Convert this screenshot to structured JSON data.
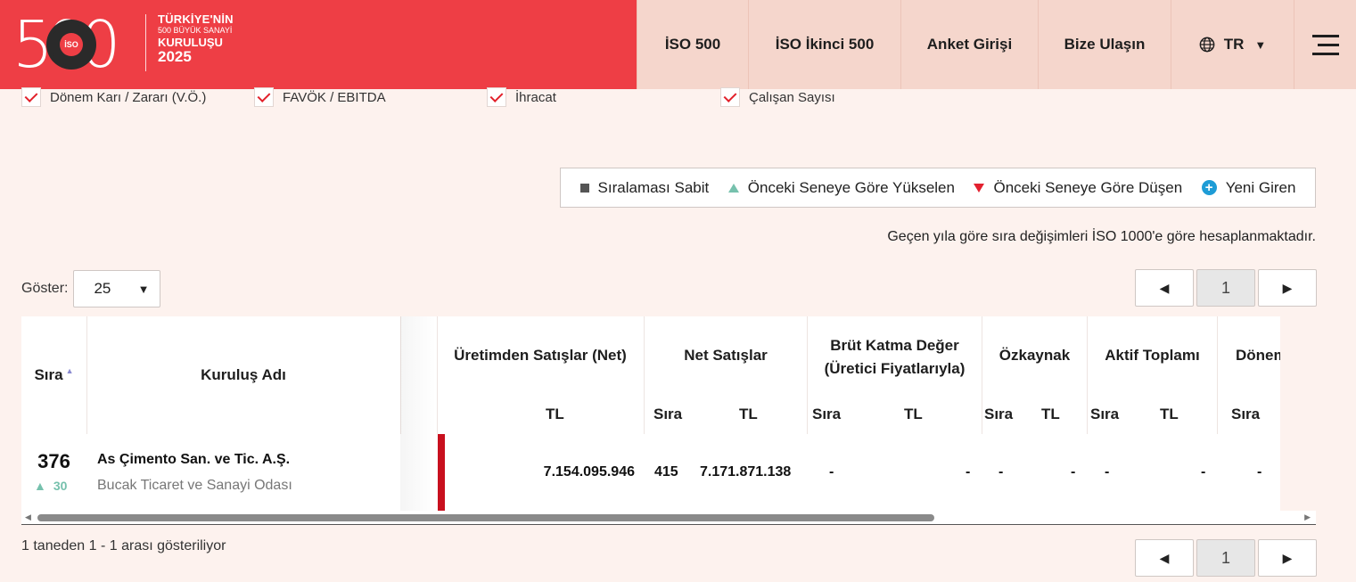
{
  "brand": {
    "logo_number": "500",
    "logo_badge": "İSO",
    "line1": "TÜRKİYE'NİN",
    "line2": "500 BÜYÜK SANAYİ",
    "line3": "KURULUŞU",
    "line4": "2025",
    "accent_color": "#ee3e45"
  },
  "nav": {
    "items": [
      "İSO 500",
      "İSO İkinci 500",
      "Anket Girişi",
      "Bize Ulaşın"
    ],
    "language": "TR",
    "language_icon": "globe-icon",
    "menu_icon": "hamburger-menu-icon"
  },
  "filters": {
    "checkboxes": [
      "Dönem Karı / Zararı (V.Ö.)",
      "FAVÖK / EBITDA",
      "İhracat",
      "Çalışan Sayısı"
    ]
  },
  "legend": {
    "items": [
      "Sıralaması Sabit",
      "Önceki Seneye Göre Yükselen",
      "Önceki Seneye Göre Düşen",
      "Yeni Giren"
    ],
    "colors": {
      "fixed": "#555555",
      "up": "#76c1ad",
      "down": "#e3212f",
      "new": "#1e9cd6"
    }
  },
  "note": "Geçen yıla göre sıra değişimleri İSO 1000'e göre hesaplanmaktadır.",
  "show": {
    "label": "Göster:",
    "value": "25"
  },
  "pagination": {
    "prev": "◀",
    "current": "1",
    "next": "▶"
  },
  "table": {
    "headers": {
      "rank": "Sıra",
      "name": "Kuruluş Adı",
      "production_sales": "Üretimden Satışlar (Net)",
      "net_sales": "Net Satışlar",
      "gross_value_added": "Brüt Katma Değer (Üretici Fiyatlarıyla)",
      "equity": "Özkaynak",
      "total_assets": "Aktif Toplamı",
      "period": "Dönem"
    },
    "subheaders": {
      "rank": "Sıra",
      "tl": "TL"
    },
    "rows": [
      {
        "rank": "376",
        "rank_change": "30",
        "company": "As Çimento San. ve Tic. A.Ş.",
        "chamber": "Bucak Ticaret ve Sanayi Odası",
        "production_sales_tl": "7.154.095.946",
        "net_sales_rank": "415",
        "net_sales_tl": "7.171.871.138",
        "gva_rank": "-",
        "gva_tl": "-",
        "equity_rank": "-",
        "equity_tl": "-",
        "assets_rank": "-",
        "assets_tl": "-",
        "period_rank": "-"
      }
    ]
  },
  "info": "1 taneden 1 - 1 arası gösteriliyor"
}
